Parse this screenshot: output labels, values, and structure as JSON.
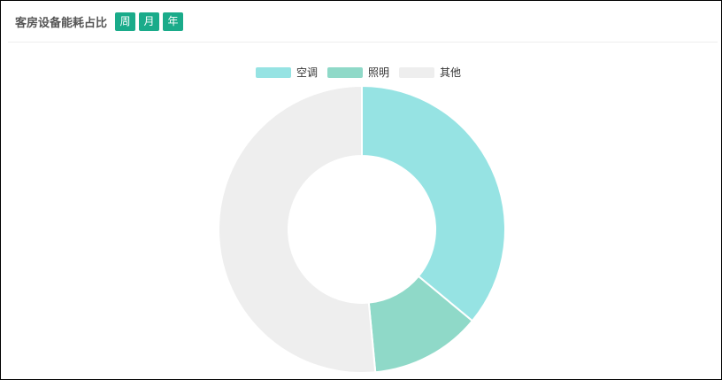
{
  "header": {
    "title": "客房设备能耗占比",
    "buttons": [
      "周",
      "月",
      "年"
    ]
  },
  "chart_data": {
    "type": "pie",
    "variant": "donut",
    "categories": [
      "空调",
      "照明",
      "其他"
    ],
    "values": [
      36,
      12.5,
      51.5
    ],
    "colors": [
      "#96e3e3",
      "#8fd9c8",
      "#eeeeee"
    ],
    "legend": "top-center"
  }
}
